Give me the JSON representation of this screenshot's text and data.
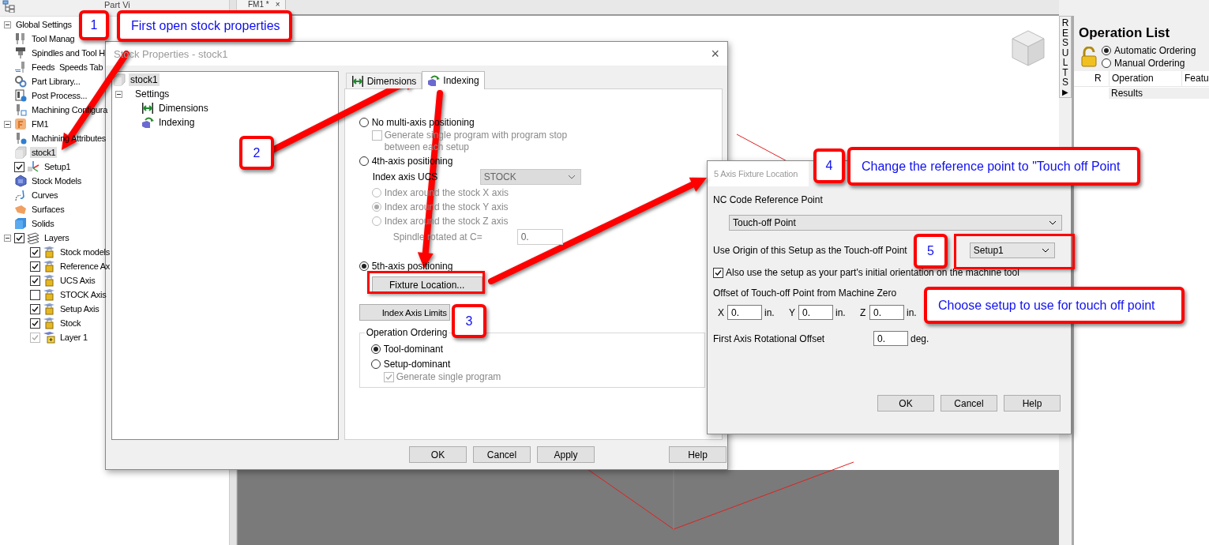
{
  "left_panel": {
    "header": "Part Vi",
    "tree": [
      {
        "label": "Global Settings",
        "kind": "folder",
        "expanded": true,
        "selected": false,
        "children": [
          {
            "label": "Tool Manag",
            "kind": "tool",
            "selected": false
          },
          {
            "label": "Spindles and Tool H",
            "kind": "spindle",
            "selected": false
          },
          {
            "label": "Feeds  Speeds Tab",
            "kind": "feeds",
            "selected": false
          },
          {
            "label": "Part Library...",
            "kind": "library",
            "selected": false
          },
          {
            "label": "Post Process...",
            "kind": "post",
            "selected": false
          },
          {
            "label": "Machining Configura",
            "kind": "config",
            "selected": false
          }
        ]
      },
      {
        "label": "FM1",
        "kind": "part",
        "expanded": true,
        "selected": false,
        "children": [
          {
            "label": "Machining Attributes",
            "kind": "attributes",
            "selected": false
          },
          {
            "label": "stock1",
            "kind": "stock",
            "selected": true
          },
          {
            "label": "Setup1",
            "kind": "setup",
            "checked": true,
            "selected": false
          },
          {
            "label": "Stock Models",
            "kind": "models",
            "selected": false
          },
          {
            "label": "Curves",
            "kind": "curves",
            "selected": false
          },
          {
            "label": "Surfaces",
            "kind": "surfaces",
            "selected": false
          },
          {
            "label": "Solids",
            "kind": "solids",
            "selected": false
          },
          {
            "label": "Layers",
            "kind": "layers",
            "checked": true,
            "expanded": true,
            "selected": false,
            "children": [
              {
                "label": "Stock models",
                "kind": "layer",
                "checked": true,
                "disabled": false,
                "selected": false
              },
              {
                "label": "Reference Ax",
                "kind": "layer",
                "checked": true,
                "disabled": false,
                "selected": false
              },
              {
                "label": "UCS Axis",
                "kind": "layer",
                "checked": true,
                "disabled": false,
                "selected": false
              },
              {
                "label": "STOCK Axis",
                "kind": "layer",
                "checked": false,
                "disabled": false,
                "selected": false
              },
              {
                "label": "Setup Axis",
                "kind": "layer",
                "checked": true,
                "disabled": false,
                "selected": false
              },
              {
                "label": "Stock",
                "kind": "layer",
                "checked": true,
                "disabled": false,
                "selected": false
              },
              {
                "label": "Layer 1",
                "kind": "newlayer",
                "checked": true,
                "disabled": true,
                "selected": false
              }
            ]
          }
        ]
      }
    ]
  },
  "document_tab": {
    "label": "FM1 *",
    "close": "×"
  },
  "results_tab": {
    "label": "RESULTS",
    "arrow": "▶"
  },
  "operation_list": {
    "title": "Operation List",
    "ordering": [
      {
        "label": "Automatic Ordering",
        "selected": true
      },
      {
        "label": "Manual Ordering",
        "selected": false
      }
    ],
    "columns": [
      "R",
      "Operation",
      "Featu"
    ],
    "rows": [
      {
        "operation": "Results"
      }
    ]
  },
  "stock_dialog": {
    "title": "Stock Properties - stock1",
    "close": "×",
    "tree": [
      {
        "label": "stock1",
        "kind": "stock",
        "selected": true
      },
      {
        "label": "Settings",
        "kind": "folder",
        "expanded": true,
        "selected": false,
        "children": [
          {
            "label": "Dimensions",
            "kind": "dimensions",
            "selected": false
          },
          {
            "label": "Indexing",
            "kind": "indexing",
            "selected": false
          }
        ]
      }
    ],
    "tabs": [
      {
        "label": "Dimensions",
        "kind": "dimensions",
        "selected": false
      },
      {
        "label": "Indexing",
        "kind": "indexing",
        "selected": true
      }
    ],
    "indexing": {
      "no_multi_axis": {
        "label": "No multi-axis positioning",
        "selected": false
      },
      "single_program_stop": {
        "label": "Generate single program with program stop between each setup",
        "checked": false,
        "disabled": true
      },
      "fourth_axis": {
        "label": "4th-axis positioning",
        "selected": false
      },
      "index_axis_ucs": {
        "label": "Index axis UCS",
        "value": "STOCK",
        "disabled": true
      },
      "index_around": [
        {
          "label": "Index around the stock X axis",
          "selected": false,
          "disabled": true
        },
        {
          "label": "Index around the stock Y axis",
          "selected": true,
          "disabled": true
        },
        {
          "label": "Index around the stock Z axis",
          "selected": false,
          "disabled": true
        }
      ],
      "spindle_rotated": {
        "label": "Spindle rotated at C=",
        "value": "0.",
        "disabled": true
      },
      "fifth_axis": {
        "label": "5th-axis positioning",
        "selected": true
      },
      "fixture_button": "Fixture Location...",
      "limits_button": "Index Axis Limits",
      "ordering": {
        "title": "Operation Ordering",
        "options": [
          {
            "label": "Tool-dominant",
            "selected": true
          },
          {
            "label": "Setup-dominant",
            "selected": false
          }
        ],
        "single_program": {
          "label": "Generate single program",
          "checked": true,
          "disabled": true
        }
      }
    },
    "buttons": [
      "OK",
      "Cancel",
      "Apply",
      "Help"
    ]
  },
  "fixture_dialog": {
    "title": "5 Axis Fixture Location",
    "reference_label": "NC Code Reference Point",
    "reference_value": "Touch-off Point",
    "origin_label": "Use Origin of this Setup as the Touch-off Point",
    "origin_value": "Setup1",
    "orientation": {
      "label": "Also use the setup as your part's initial orientation on the machine tool",
      "checked": true
    },
    "offset_label": "Offset of Touch-off Point from Machine Zero",
    "offsets": [
      {
        "axis": "X",
        "value": "0.",
        "unit": "in."
      },
      {
        "axis": "Y",
        "value": "0.",
        "unit": "in."
      },
      {
        "axis": "Z",
        "value": "0.",
        "unit": "in."
      }
    ],
    "rotation": {
      "label": "First Axis Rotational Offset",
      "value": "0.",
      "unit": "deg."
    },
    "buttons": [
      "OK",
      "Cancel",
      "Help"
    ]
  },
  "annotations": [
    {
      "kind": "number",
      "text": "1"
    },
    {
      "kind": "note",
      "text": "First open stock properties"
    },
    {
      "kind": "number",
      "text": "2"
    },
    {
      "kind": "number",
      "text": "3"
    },
    {
      "kind": "number",
      "text": "4"
    },
    {
      "kind": "note",
      "text": "Change the reference point to \"Touch off Point"
    },
    {
      "kind": "number",
      "text": "5"
    },
    {
      "kind": "note",
      "text": "Choose setup to use for touch off point"
    }
  ]
}
